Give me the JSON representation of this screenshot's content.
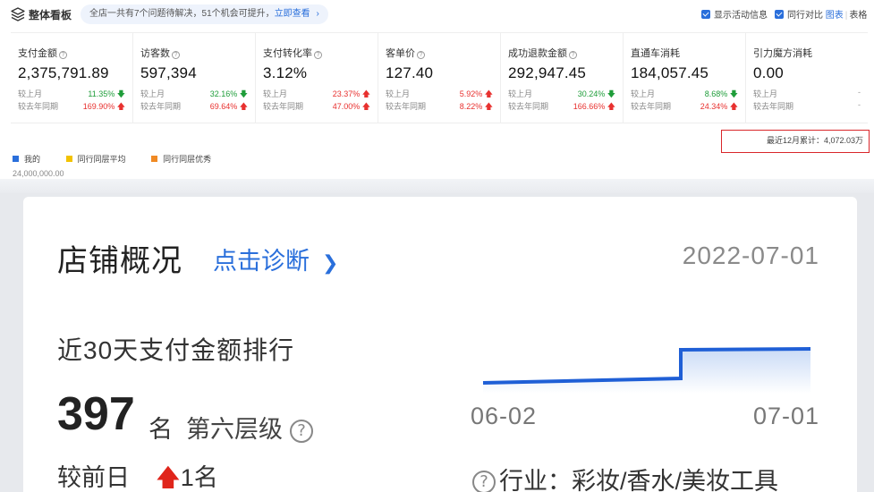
{
  "header": {
    "title": "整体看板",
    "notice_text": "全店一共有7个问题待解决，51个机会可提升，",
    "notice_link": "立即查看",
    "option_activity": "显示活动信息",
    "option_compare": "同行对比",
    "view_chart": "图表",
    "view_table": "表格"
  },
  "metrics": [
    {
      "label": "支付金额",
      "value": "2,375,791.89",
      "r1_label": "较上月",
      "r1_value": "11.35%",
      "r1_dir": "down",
      "r2_label": "较去年同期",
      "r2_value": "169.90%",
      "r2_dir": "up"
    },
    {
      "label": "访客数",
      "value": "597,394",
      "r1_label": "较上月",
      "r1_value": "32.16%",
      "r1_dir": "down",
      "r2_label": "较去年同期",
      "r2_value": "69.64%",
      "r2_dir": "up"
    },
    {
      "label": "支付转化率",
      "value": "3.12%",
      "r1_label": "较上月",
      "r1_value": "23.37%",
      "r1_dir": "up",
      "r2_label": "较去年同期",
      "r2_value": "47.00%",
      "r2_dir": "up"
    },
    {
      "label": "客单价",
      "value": "127.40",
      "r1_label": "较上月",
      "r1_value": "5.92%",
      "r1_dir": "up",
      "r2_label": "较去年同期",
      "r2_value": "8.22%",
      "r2_dir": "up"
    },
    {
      "label": "成功退款金额",
      "value": "292,947.45",
      "r1_label": "较上月",
      "r1_value": "30.24%",
      "r1_dir": "down",
      "r2_label": "较去年同期",
      "r2_value": "166.66%",
      "r2_dir": "up"
    },
    {
      "label": "直通车消耗",
      "value": "184,057.45",
      "r1_label": "较上月",
      "r1_value": "8.68%",
      "r1_dir": "down",
      "r2_label": "较去年同期",
      "r2_value": "24.34%",
      "r2_dir": "up"
    },
    {
      "label": "引力魔方消耗",
      "value": "0.00",
      "r1_label": "较上月",
      "r1_value": "-",
      "r1_dir": "none",
      "r2_label": "较去年同期",
      "r2_value": "-",
      "r2_dir": "none"
    }
  ],
  "legend": [
    {
      "label": "我的",
      "color": "#2a6fdb"
    },
    {
      "label": "同行同层平均",
      "color": "#f2c200"
    },
    {
      "label": "同行同层优秀",
      "color": "#f08a24"
    }
  ],
  "axis_top_value": "24,000,000.00",
  "cumulative_text": "最近12月累计：4,072.03万",
  "card": {
    "title": "店铺概况",
    "diagnose": "点击诊断",
    "date": "2022-07-01",
    "rank_title": "近30天支付金额排行",
    "rank_number": "397",
    "rank_unit": "名",
    "rank_level": "第六层级",
    "compare_label": "较前日",
    "compare_value": "1名",
    "x_start": "06-02",
    "x_end": "07-01",
    "industry": "行业：彩妆/香水/美妆工具"
  },
  "colors": {
    "accent": "#2a6fdb",
    "up": "#e8312f",
    "down": "#1f9d3a",
    "highlight_border": "#d9262a"
  }
}
